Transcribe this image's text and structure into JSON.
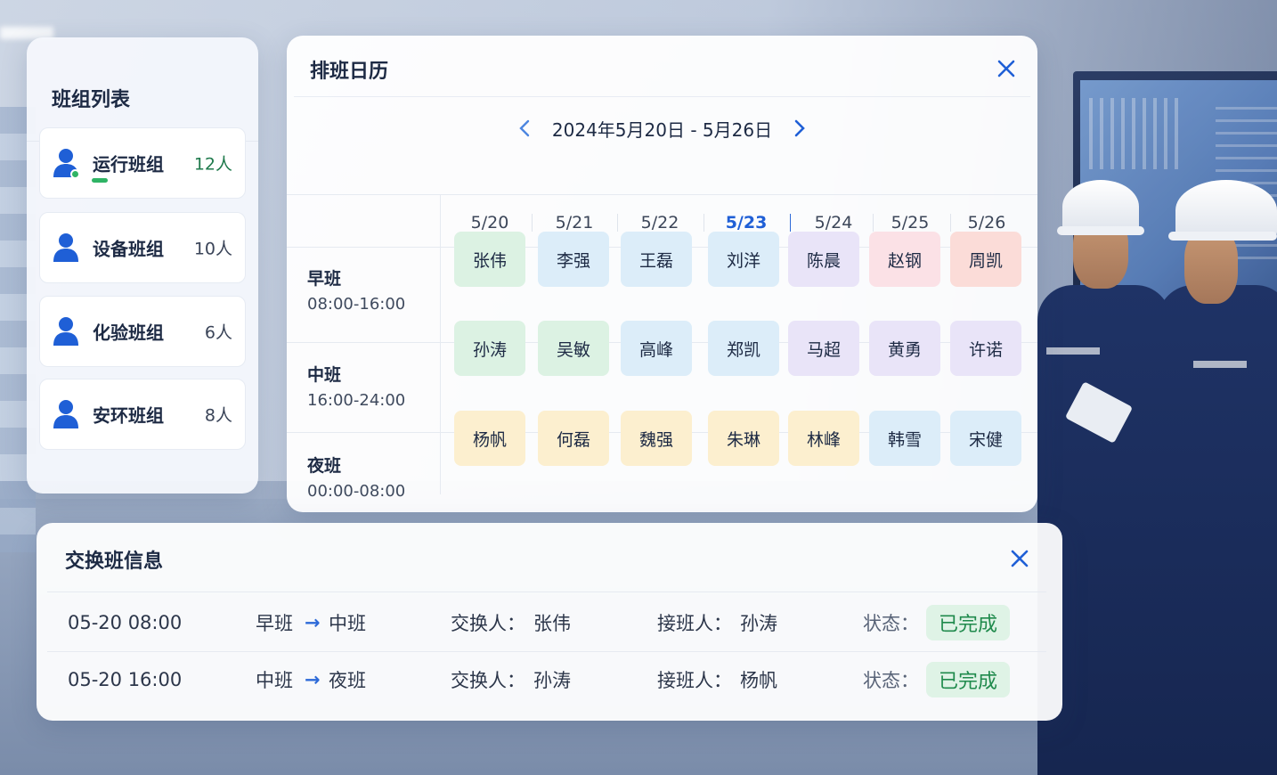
{
  "team_list": {
    "title": "班组列表",
    "items": [
      {
        "name": "运行班组",
        "count": "12人"
      },
      {
        "name": "设备班组",
        "count": "10人"
      },
      {
        "name": "化验班组",
        "count": "6人"
      },
      {
        "name": "安环班组",
        "count": "8人"
      }
    ]
  },
  "calendar": {
    "title": "排班日历",
    "range": "2024年5月20日 - 5月26日",
    "dates": [
      "5/20",
      "5/21",
      "5/22",
      "5/23",
      "5/24",
      "5/25",
      "5/26"
    ],
    "highlighted_date": "5/23",
    "shifts": [
      {
        "name": "早班",
        "time": "08:00-16:00",
        "people": [
          "张伟",
          "李强",
          "王磊",
          "刘洋",
          "陈晨",
          "赵钢",
          "周凯"
        ]
      },
      {
        "name": "中班",
        "time": "16:00-24:00",
        "people": [
          "孙涛",
          "吴敏",
          "高峰",
          "郑凯",
          "马超",
          "黄勇",
          "许诺"
        ]
      },
      {
        "name": "夜班",
        "time": "00:00-08:00",
        "people": [
          "杨帆",
          "何磊",
          "魏强",
          "朱琳",
          "林峰",
          "韩雪",
          "宋健"
        ]
      }
    ]
  },
  "swap_info": {
    "title": "交换班信息",
    "label_swapper": "交换人：",
    "label_receiver": "接班人：",
    "label_status": "状态：",
    "rows": [
      {
        "time": "05-20 08:00",
        "from": "早班",
        "to": "中班",
        "swapper": "张伟",
        "receiver": "孙涛",
        "status": "已完成"
      },
      {
        "time": "05-20 16:00",
        "from": "中班",
        "to": "夜班",
        "swapper": "孙涛",
        "receiver": "杨帆",
        "status": "已完成"
      }
    ]
  },
  "colors": {
    "accent": "#2d6ad8",
    "green": "#dff3e6",
    "blue": "#dcedf9",
    "purple": "#e9e4f8",
    "pink": "#fbe1e6",
    "red": "#fbdcd8",
    "yellow": "#fcefcf"
  }
}
